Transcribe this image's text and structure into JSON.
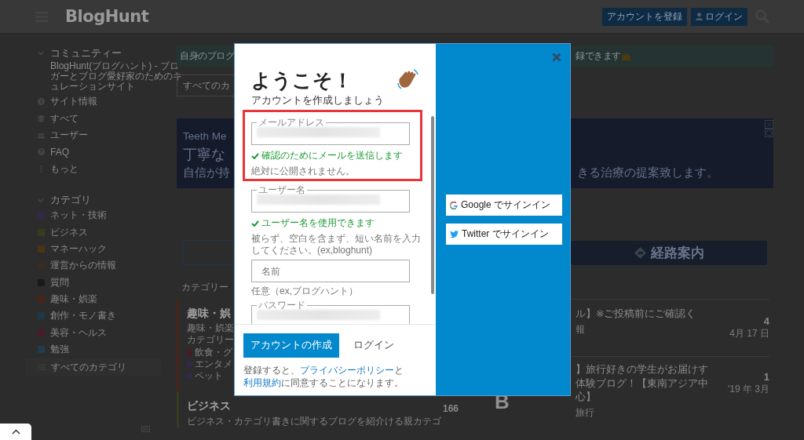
{
  "header": {
    "logo": "BlogHunt",
    "register_button": "アカウントを登録",
    "login_button": "ログイン"
  },
  "sidebar": {
    "community": {
      "title": "コミュニティー",
      "expanded": true,
      "description": "BlogHunt(ブログハント) - ブロガーとブログ愛好家のためのキュレーションサイト",
      "items": [
        "サイト情報",
        "すべて",
        "ユーザー",
        "FAQ",
        "もっと"
      ]
    },
    "categories": {
      "title": "カテゴリ",
      "expanded": true,
      "items": [
        {
          "label": "ネット・技術",
          "color": "#33284a"
        },
        {
          "label": "ビジネス",
          "color": "#383c1e"
        },
        {
          "label": "マネーハック",
          "color": "#4a3414"
        },
        {
          "label": "運営からの情報",
          "color": "#3a2b1f"
        },
        {
          "label": "質問",
          "color": "#1a1a1a"
        },
        {
          "label": "趣味・娯楽",
          "color": "#4a2318"
        },
        {
          "label": "創作・モノ書き",
          "color": "#1f3849"
        },
        {
          "label": "美容・ヘルス",
          "color": "#4a1b2b"
        },
        {
          "label": "勉強",
          "color": "#1e3d4c"
        }
      ],
      "all_label": "すべてのカテゴリ",
      "all_selected": true
    }
  },
  "main": {
    "notice": {
      "left": "自身のブログ",
      "right": "録できます"
    },
    "category_select": "すべてのカ",
    "ad": {
      "line_1": "Teeth Me",
      "line_2": "丁寧な",
      "line_3": "自信が持",
      "line_3_end": "きる治療の提案致します。"
    },
    "directions_button": "経路案内",
    "categories_heading": "カテゴリー",
    "category_cards": [
      {
        "title": "趣味・娯",
        "description": [
          "趣味・娯楽",
          "カテゴリー"
        ],
        "color": "#4a2318",
        "tags": [
          {
            "label": "飲食・グ",
            "color": "#4a1b22"
          },
          {
            "label": "エンタメ",
            "color": "#33284a"
          },
          {
            "label": "ペット",
            "color": "#33284a"
          }
        ]
      },
      {
        "title": "ビジネス",
        "description": [
          "ビジネス・カテゴリ書きに関するブログを紹介ける親カテゴ"
        ],
        "color": "#383c1e",
        "count": "166"
      }
    ],
    "topics": [
      {
        "title": [
          "ル】※ご投稿前にご確認く"
        ],
        "category": "報",
        "replies": "4",
        "date": "4月 17 日"
      },
      {
        "title": [
          "】旅行好きの学生がお届けす",
          "体験ブログ！【東南アジア中",
          "心】"
        ],
        "category": "旅行",
        "replies": "1",
        "date": "'19 年 3月",
        "avatar_letter": "B"
      }
    ]
  },
  "dialog": {
    "title": "ようこそ！",
    "subtitle": "アカウントを作成しましょう",
    "fields": [
      {
        "kind": "outlined",
        "label": "メールアドレス",
        "blurred": true,
        "status": "確認のためにメールを送信します",
        "valid": true,
        "hint": "絶対に公開されません。"
      },
      {
        "kind": "outlined",
        "label": "ユーザー名",
        "blurred": true,
        "status": "ユーザー名を使用できます",
        "valid": true,
        "hint": "被らず、空白を含まず、短い名前を入力してください。(ex,bloghunt)"
      },
      {
        "kind": "plain",
        "placeholder": "名前",
        "hint": "任意（ex,ブログハント）"
      },
      {
        "kind": "outlined",
        "label": "パスワード",
        "blurred": true
      }
    ],
    "create_button": "アカウントの作成",
    "login_link": "ログイン",
    "terms": {
      "before": "登録すると、",
      "link_1": "プライバシーポリシー",
      "middle": "と",
      "link_2": "利用規約",
      "after": "に同意することになります。"
    },
    "social_buttons": [
      "Google でサインイン",
      "Twitter でサインイン"
    ],
    "highlight": true
  }
}
